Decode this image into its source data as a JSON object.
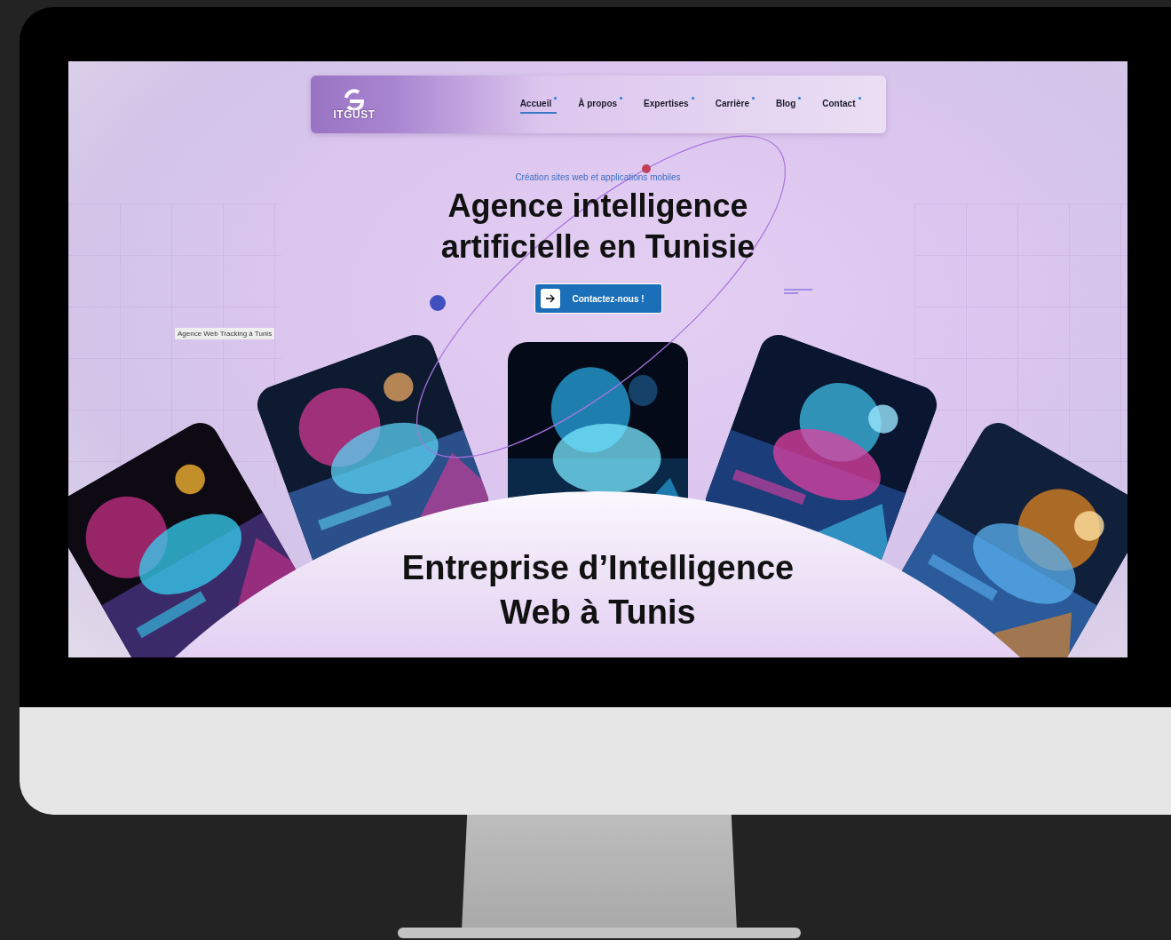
{
  "nav": {
    "logo": "ITGUST",
    "links": [
      {
        "label": "Accueil",
        "selected": true
      },
      {
        "label": "À propos",
        "selected": false
      },
      {
        "label": "Expertises",
        "selected": false
      },
      {
        "label": "Carrière",
        "selected": false
      },
      {
        "label": "Blog",
        "selected": false
      },
      {
        "label": "Contact",
        "selected": false
      }
    ]
  },
  "hero": {
    "eyebrow": "Création sites web et applications mobiles",
    "title_lines": [
      "Agence intelligence",
      "artificielle en Tunisie"
    ],
    "cta": "Contactez-nous !"
  },
  "side_label": "Agence Web Tracking à Tunis",
  "section_title_lines": [
    "Entreprise d’Intelligence",
    "Web à Tunis"
  ]
}
